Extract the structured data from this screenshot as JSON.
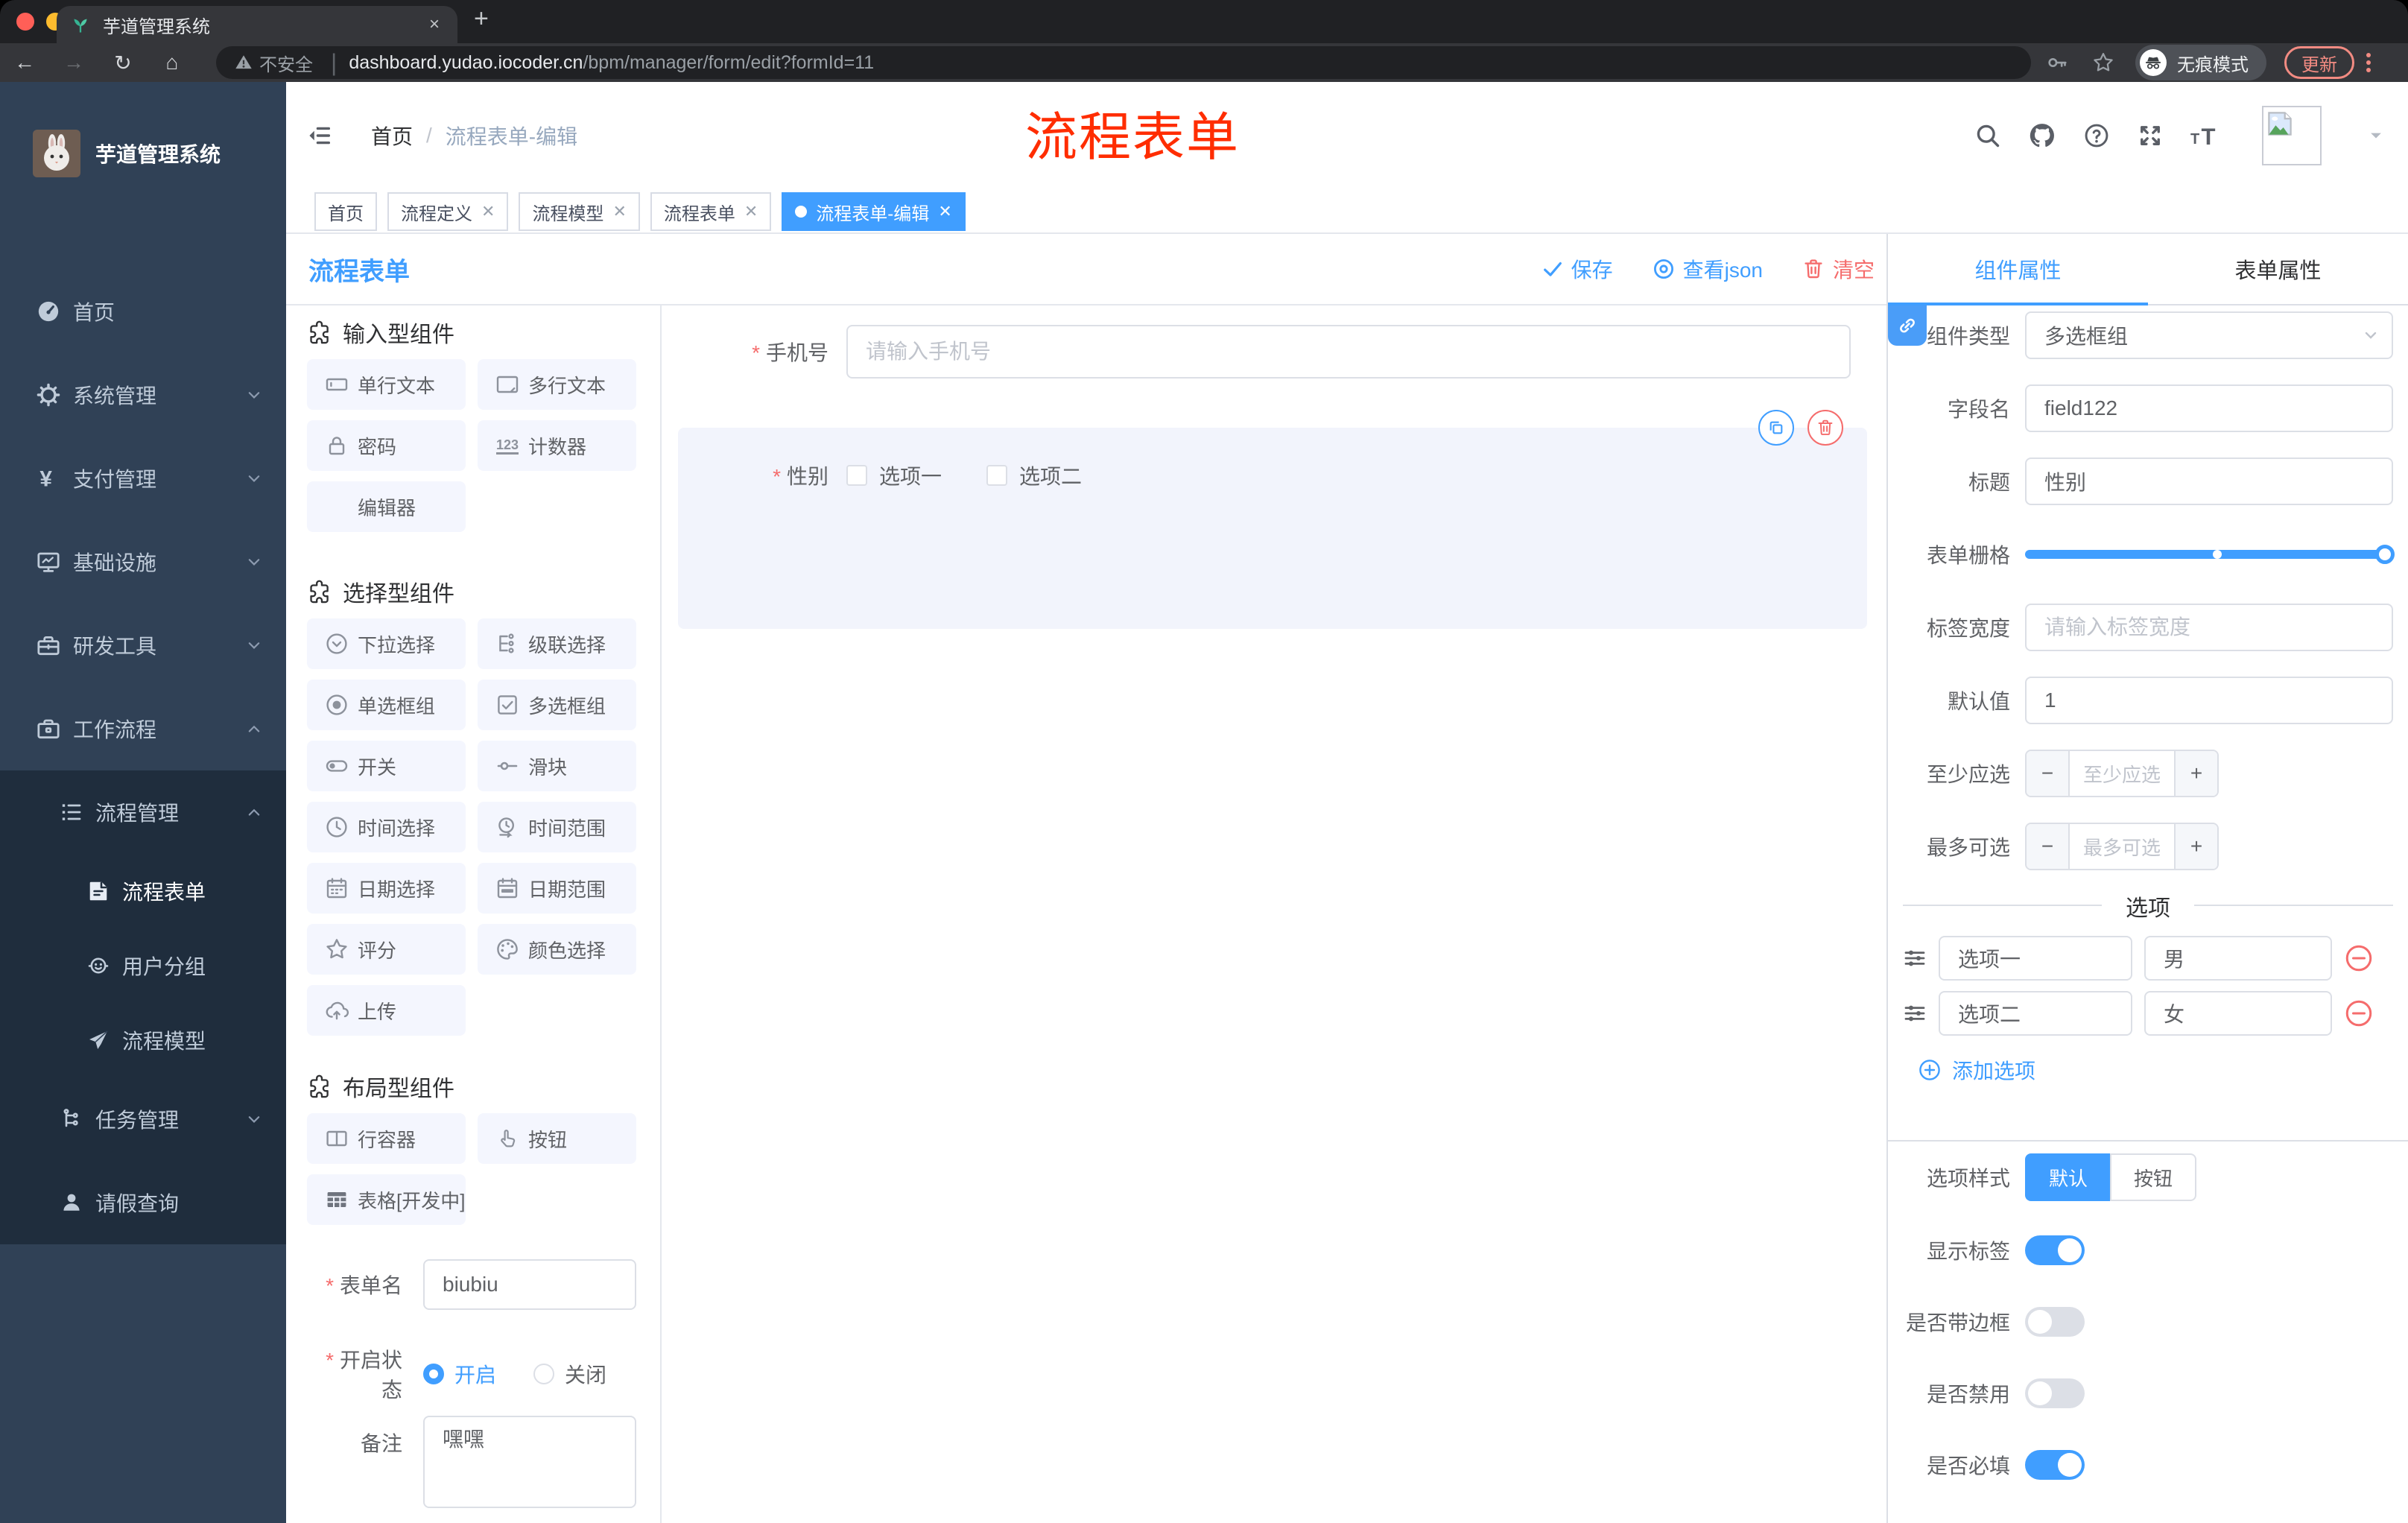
{
  "colors": {
    "accent": "#409EFF",
    "danger": "#F56C6C",
    "annotation_red": "#FF2D00",
    "sidebar_bg": "#304156",
    "submenu_bg": "#1F2D3D",
    "incognito_update": "#F28B82"
  },
  "browser": {
    "tab_title": "芋道管理系统",
    "close_glyph": "×",
    "security_label": "不安全",
    "url_host": "dashboard.yudao.iocoder.cn",
    "url_path": "/bpm/manager/form/edit?formId=11",
    "incognito_label": "无痕模式",
    "update_label": "更新",
    "back_glyph": "←",
    "forward_glyph": "→",
    "reload_glyph": "↻",
    "home_glyph": "⌂",
    "newtab_glyph": "+"
  },
  "sidebar": {
    "app_title": "芋道管理系统",
    "items": [
      {
        "label": "首页",
        "icon": "dashboard-icon"
      },
      {
        "label": "系统管理",
        "icon": "gear-icon"
      },
      {
        "label": "支付管理",
        "icon": "yen-icon"
      },
      {
        "label": "基础设施",
        "icon": "monitor-icon"
      },
      {
        "label": "研发工具",
        "icon": "toolbox-icon"
      },
      {
        "label": "工作流程",
        "icon": "briefcase-icon"
      }
    ],
    "sub": {
      "label": "流程管理",
      "icon": "list-icon",
      "children": [
        {
          "label": "流程表单",
          "icon": "form-icon",
          "active": true
        },
        {
          "label": "用户分组",
          "icon": "group-icon"
        },
        {
          "label": "流程模型",
          "icon": "send-icon"
        }
      ]
    },
    "tail": [
      {
        "label": "任务管理",
        "icon": "tree-icon"
      },
      {
        "label": "请假查询",
        "icon": "user-icon"
      }
    ]
  },
  "header": {
    "breadcrumb_home": "首页",
    "breadcrumb_sep": "/",
    "breadcrumb_current": "流程表单-编辑",
    "annotation": "流程表单"
  },
  "tags": [
    {
      "label": "首页"
    },
    {
      "label": "流程定义"
    },
    {
      "label": "流程模型"
    },
    {
      "label": "流程表单"
    },
    {
      "label": "流程表单-编辑"
    }
  ],
  "toolbar": {
    "title": "流程表单",
    "save": "保存",
    "view_json": "查看json",
    "clear": "清空"
  },
  "components": {
    "sections": [
      {
        "title": "输入型组件",
        "items": [
          {
            "label": "单行文本",
            "icon": "input-icon"
          },
          {
            "label": "多行文本",
            "icon": "textarea-icon"
          },
          {
            "label": "密码",
            "icon": "lock-icon"
          },
          {
            "label": "计数器",
            "icon": "counter-icon"
          },
          {
            "label": "编辑器",
            "icon": "none"
          }
        ]
      },
      {
        "title": "选择型组件",
        "items": [
          {
            "label": "下拉选择",
            "icon": "select-icon"
          },
          {
            "label": "级联选择",
            "icon": "cascader-icon"
          },
          {
            "label": "单选框组",
            "icon": "radio-icon"
          },
          {
            "label": "多选框组",
            "icon": "checkbox-icon"
          },
          {
            "label": "开关",
            "icon": "switch-icon"
          },
          {
            "label": "滑块",
            "icon": "slider-icon"
          },
          {
            "label": "时间选择",
            "icon": "time-icon"
          },
          {
            "label": "时间范围",
            "icon": "time-range-icon"
          },
          {
            "label": "日期选择",
            "icon": "date-icon"
          },
          {
            "label": "日期范围",
            "icon": "date-range-icon"
          },
          {
            "label": "评分",
            "icon": "star-icon"
          },
          {
            "label": "颜色选择",
            "icon": "palette-icon"
          },
          {
            "label": "上传",
            "icon": "upload-icon"
          }
        ]
      },
      {
        "title": "布局型组件",
        "items": [
          {
            "label": "行容器",
            "icon": "row-container-icon"
          },
          {
            "label": "按钮",
            "icon": "hand-pointer-icon"
          },
          {
            "label": "表格[开发中]",
            "icon": "table-icon"
          }
        ]
      }
    ]
  },
  "canvas": {
    "phone_label": "手机号",
    "phone_placeholder": "请输入手机号",
    "gender_label": "性别",
    "gender_option1": "选项一",
    "gender_option2": "选项二"
  },
  "meta": {
    "form_name_label": "表单名",
    "form_name_value": "biubiu",
    "status_label": "开启状态",
    "status_on": "开启",
    "status_off": "关闭",
    "remark_label": "备注",
    "remark_value": "嘿嘿"
  },
  "panel": {
    "tab_component": "组件属性",
    "tab_form": "表单属性",
    "type_label": "组件类型",
    "type_value": "多选框组",
    "field_label": "字段名",
    "field_value": "field122",
    "title_label": "标题",
    "title_value": "性别",
    "grid_label": "表单栅格",
    "label_width_label": "标签宽度",
    "label_width_placeholder": "请输入标签宽度",
    "default_label": "默认值",
    "default_value": "1",
    "min_label": "至少应选",
    "min_placeholder": "至少应选",
    "max_label": "最多可选",
    "max_placeholder": "最多可选",
    "options_divider": "选项",
    "options": [
      {
        "label": "选项一",
        "value": "男"
      },
      {
        "label": "选项二",
        "value": "女"
      }
    ],
    "add_option": "添加选项",
    "style_label": "选项样式",
    "style_default": "默认",
    "style_button": "按钮",
    "show_label": "显示标签",
    "border_label": "是否带边框",
    "disabled_label": "是否禁用",
    "required_label": "是否必填",
    "minus_glyph": "−",
    "plus_glyph": "+"
  }
}
